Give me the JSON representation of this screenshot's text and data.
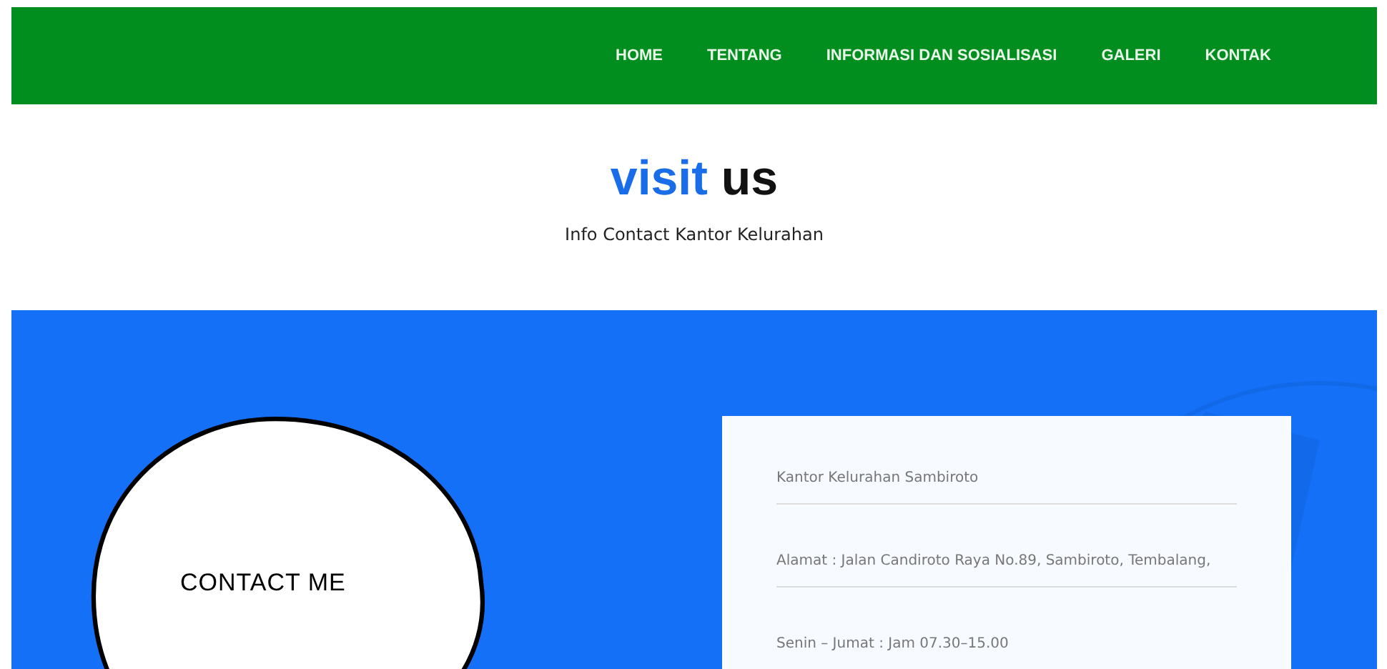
{
  "nav": [
    {
      "label": "HOME"
    },
    {
      "label": "TENTANG"
    },
    {
      "label": "INFORMASI DAN SOSIALISASI"
    },
    {
      "label": "GALERI"
    },
    {
      "label": "KONTAK"
    }
  ],
  "heading": {
    "accent": "visit",
    "rest": "us",
    "subtitle": "Info Contact Kantor Kelurahan"
  },
  "bubble": {
    "text": "CONTACT ME"
  },
  "contact_lines": [
    "Kantor Kelurahan Sambiroto",
    "Alamat : Jalan Candiroto Raya No.89, Sambiroto, Tembalang,",
    "Senin – Jumat : Jam 07.30–15.00"
  ]
}
